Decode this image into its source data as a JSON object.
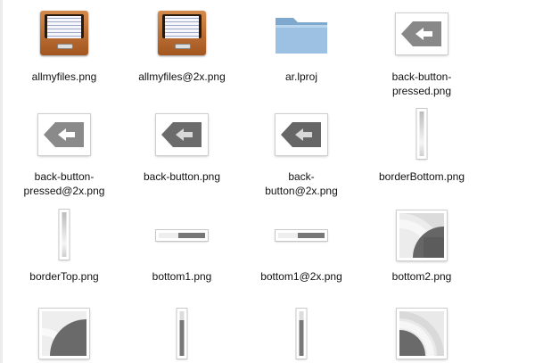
{
  "files": [
    {
      "name": "allmyfiles.png",
      "icon": "drawer-icon"
    },
    {
      "name": "allmyfiles@2x.png",
      "icon": "drawer-icon"
    },
    {
      "name": "ar.lproj",
      "icon": "folder-icon"
    },
    {
      "name": "back-button-pressed.png",
      "label_lines": [
        "back-button-",
        "pressed.png"
      ],
      "icon": "back-arrow-icon"
    },
    {
      "name": "back-button-pressed@2x.png",
      "label_lines": [
        "back-button-",
        "pressed@2x.png"
      ],
      "icon": "back-arrow-icon"
    },
    {
      "name": "back-button.png",
      "icon": "back-arrow-icon"
    },
    {
      "name": "back-button@2x.png",
      "label_lines": [
        "back-",
        "button@2x.png"
      ],
      "icon": "back-arrow-icon"
    },
    {
      "name": "borderBottom.png",
      "icon": "vertical-bar-icon"
    },
    {
      "name": "borderTop.png",
      "icon": "vertical-bar-icon"
    },
    {
      "name": "bottom1.png",
      "icon": "horizontal-bar-icon"
    },
    {
      "name": "bottom1@2x.png",
      "icon": "horizontal-bar-icon"
    },
    {
      "name": "bottom2.png",
      "icon": "corner-thumbnail-icon"
    },
    {
      "name": "",
      "icon": "corner-thumbnail-icon"
    },
    {
      "name": "",
      "icon": "vertical-bar-icon"
    },
    {
      "name": "",
      "icon": "vertical-bar-icon"
    },
    {
      "name": "",
      "icon": "corner-thumbnail-icon"
    }
  ],
  "colors": {
    "folder": "#8fb4d8",
    "arrow_dark": "#666666",
    "arrow_pressed": "#555555"
  }
}
